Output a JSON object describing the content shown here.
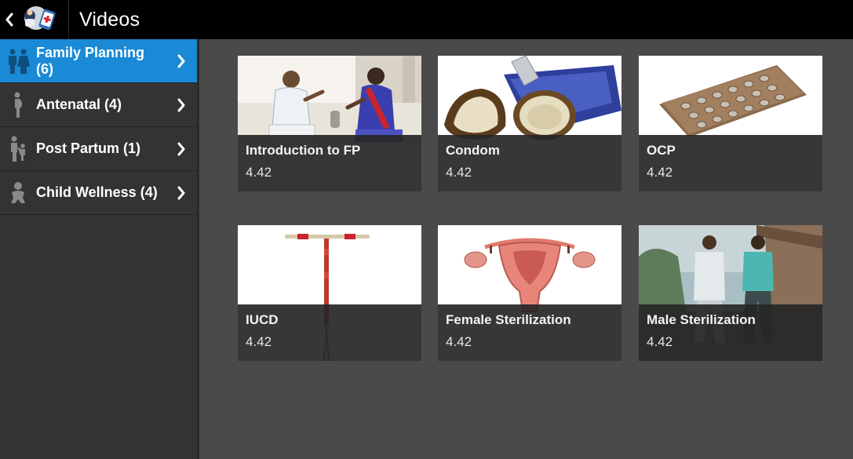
{
  "app": {
    "title": "Videos"
  },
  "sidebar": {
    "items": [
      {
        "label": "Family Planning (6)",
        "icon": "couple-icon",
        "active": true
      },
      {
        "label": "Antenatal (4)",
        "icon": "pregnant-woman-icon",
        "active": false
      },
      {
        "label": "Post Partum (1)",
        "icon": "mother-child-icon",
        "active": false
      },
      {
        "label": "Child Wellness (4)",
        "icon": "baby-icon",
        "active": false
      }
    ]
  },
  "videos": [
    {
      "title": "Introduction to FP",
      "duration": "4.42",
      "thumbnail": "couple-talking-illustration"
    },
    {
      "title": "Condom",
      "duration": "4.42",
      "thumbnail": "condom-packet-illustration"
    },
    {
      "title": "OCP",
      "duration": "4.42",
      "thumbnail": "pill-strip-illustration"
    },
    {
      "title": "IUCD",
      "duration": "4.42",
      "thumbnail": "t-shaped-iud-illustration"
    },
    {
      "title": "Female Sterilization",
      "duration": "4.42",
      "thumbnail": "uterus-illustration"
    },
    {
      "title": "Male Sterilization",
      "duration": "4.42",
      "thumbnail": "men-walking-illustration"
    }
  ],
  "colors": {
    "topbar": "#000000",
    "sidebar": "#333333",
    "active_item": "#1a8ad6",
    "content_bg": "#4a4a4a",
    "card_overlay": "#262626"
  }
}
